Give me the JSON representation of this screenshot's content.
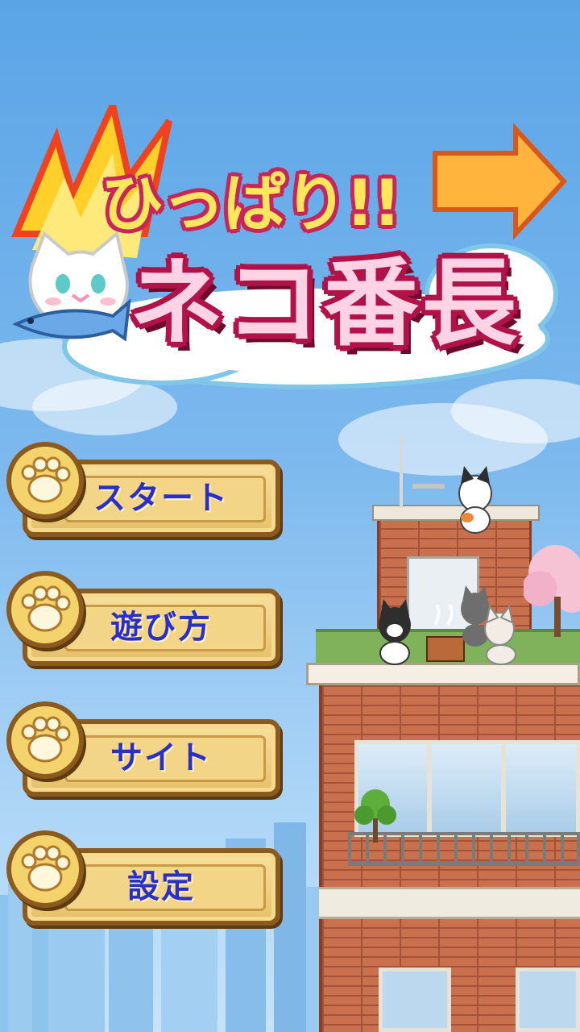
{
  "game": {
    "title_line1": "ひっぱり!!",
    "title_line2": "ネコ番長"
  },
  "menu": [
    {
      "label": "スタート",
      "icon": "paw-icon"
    },
    {
      "label": "遊び方",
      "icon": "paw-icon"
    },
    {
      "label": "サイト",
      "icon": "paw-icon"
    },
    {
      "label": "設定",
      "icon": "paw-icon"
    }
  ],
  "colors": {
    "sky_top": "#5aa4e6",
    "button_text": "#2a2fc9",
    "button_wood": "#f3d587",
    "title_pink": "#ffd3e4",
    "title_yellow": "#ffe65c",
    "title_outline": "#b11348",
    "brick": "#c9714f"
  }
}
